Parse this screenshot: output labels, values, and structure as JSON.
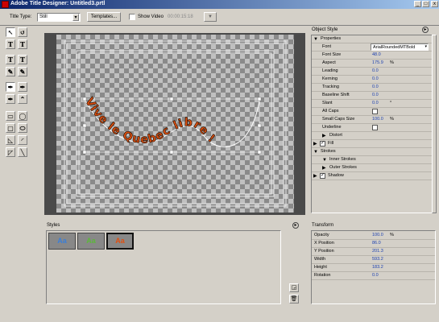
{
  "window": {
    "title": "Adobe Title Designer: Untitled3.prtl",
    "min": "_",
    "max": "□",
    "close": "x"
  },
  "toolbar": {
    "title_type_label": "Title Type:",
    "title_type_value": "Still",
    "templates_label": "Templates...",
    "show_video_label": "Show Video",
    "timecode": "00:00:15:18"
  },
  "tools": [
    {
      "name": "selection-tool-icon",
      "glyph": "↖"
    },
    {
      "name": "rotation-tool-icon",
      "glyph": "↺"
    },
    {
      "name": "type-tool-icon",
      "glyph": "T"
    },
    {
      "name": "vertical-type-tool-icon",
      "glyph": "T"
    },
    {
      "name": "area-type-tool-icon",
      "glyph": "T"
    },
    {
      "name": "vertical-area-type-tool-icon",
      "glyph": "T"
    },
    {
      "name": "path-type-tool-icon",
      "glyph": "✎"
    },
    {
      "name": "vertical-path-type-tool-icon",
      "glyph": "✎"
    },
    {
      "name": "pen-tool-icon",
      "glyph": "✒"
    },
    {
      "name": "add-anchor-tool-icon",
      "glyph": "✒"
    },
    {
      "name": "delete-anchor-tool-icon",
      "glyph": "✒"
    },
    {
      "name": "convert-anchor-tool-icon",
      "glyph": "⌃"
    },
    {
      "name": "rectangle-tool-icon",
      "glyph": "▭"
    },
    {
      "name": "ellipse-tool-icon",
      "glyph": "◯"
    },
    {
      "name": "rounded-rectangle-tool-icon",
      "glyph": "▢"
    },
    {
      "name": "clipped-corner-tool-icon",
      "glyph": "⬭"
    },
    {
      "name": "wedge-tool-icon",
      "glyph": "◺"
    },
    {
      "name": "arc-tool-icon",
      "glyph": "◜"
    },
    {
      "name": "polygon-tool-icon",
      "glyph": "◸"
    },
    {
      "name": "line-tool-icon",
      "glyph": "╲"
    }
  ],
  "canvas": {
    "text": "Vive le Quebec libre !"
  },
  "styles_panel": {
    "title": "Styles",
    "swatches": [
      "Aa",
      "Aa",
      "Aa"
    ]
  },
  "object_style": {
    "title": "Object Style",
    "sections": [
      {
        "label": "Properties",
        "type": "section",
        "expanded": true
      },
      {
        "label": "Font",
        "value": "ArialRoundedMTBold",
        "type": "dropdown"
      },
      {
        "label": "Font Size",
        "value": "48.0",
        "type": "value"
      },
      {
        "label": "Aspect",
        "value": "175.9",
        "unit": "%",
        "type": "value"
      },
      {
        "label": "Leading",
        "value": "0.0",
        "type": "value"
      },
      {
        "label": "Kerning",
        "value": "0.0",
        "type": "value"
      },
      {
        "label": "Tracking",
        "value": "0.0",
        "type": "value"
      },
      {
        "label": "Baseline Shift",
        "value": "0.0",
        "type": "value"
      },
      {
        "label": "Slant",
        "value": "0.0",
        "unit": "°",
        "type": "value"
      },
      {
        "label": "All Caps",
        "type": "check",
        "checked": false
      },
      {
        "label": "Small Caps Size",
        "value": "100.0",
        "unit": "%",
        "type": "value"
      },
      {
        "label": "Underline",
        "type": "check",
        "checked": false
      },
      {
        "label": "Distort",
        "type": "sub",
        "expanded": false
      },
      {
        "label": "Fill",
        "type": "section-check",
        "checked": true,
        "expanded": false
      },
      {
        "label": "Strokes",
        "type": "section",
        "expanded": true
      },
      {
        "label": "Inner Strokes",
        "type": "sub",
        "expanded": true
      },
      {
        "label": "Outer Strokes",
        "type": "sub",
        "expanded": false
      },
      {
        "label": "Shadow",
        "type": "section-check",
        "checked": true,
        "expanded": false
      }
    ]
  },
  "transform": {
    "title": "Transform",
    "rows": [
      {
        "label": "Opacity",
        "value": "100.0",
        "unit": "%"
      },
      {
        "label": "X Position",
        "value": "86.0"
      },
      {
        "label": "Y Position",
        "value": "201.3"
      },
      {
        "label": "Width",
        "value": "593.2"
      },
      {
        "label": "Height",
        "value": "183.2"
      },
      {
        "label": "Rotation",
        "value": "0.0"
      }
    ]
  },
  "colors": {
    "titlebar": "#0a246a",
    "value_blue": "#1a3fb0",
    "stage": "#4a4a4a"
  }
}
